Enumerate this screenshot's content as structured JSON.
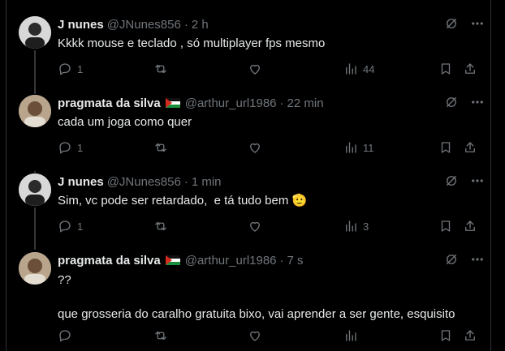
{
  "tweets": [
    {
      "name": "J nunes",
      "handle": "@JNunes856",
      "time": "2 h",
      "text": "Kkkk mouse e teclado , só multiplayer fps mesmo",
      "replies": "1",
      "views": "44",
      "avatar": "person-photo",
      "flag": ""
    },
    {
      "name": "pragmata da silva",
      "handle": "@arthur_url1986",
      "time": "22 min",
      "text": "cada um joga como quer",
      "replies": "1",
      "views": "11",
      "avatar": "person-photo",
      "flag": "palestine-flag"
    },
    {
      "name": "J nunes",
      "handle": "@JNunes856",
      "time": "1 min",
      "text": "Sim, vc pode ser retardado,  e tá tudo bem",
      "emoji": "🫡",
      "replies": "1",
      "views": "3",
      "avatar": "person-photo",
      "flag": ""
    },
    {
      "name": "pragmata da silva",
      "handle": "@arthur_url1986",
      "time": "7 s",
      "text": "??\n\nque grosseria do caralho gratuita bixo, vai aprender a ser gente, esquisito",
      "replies": "",
      "views": "",
      "avatar": "person-photo",
      "flag": "palestine-flag"
    }
  ],
  "separator": "·",
  "colors": {
    "background": "#000000",
    "text": "#e7e9ea",
    "muted": "#71767b",
    "line": "#333639"
  }
}
